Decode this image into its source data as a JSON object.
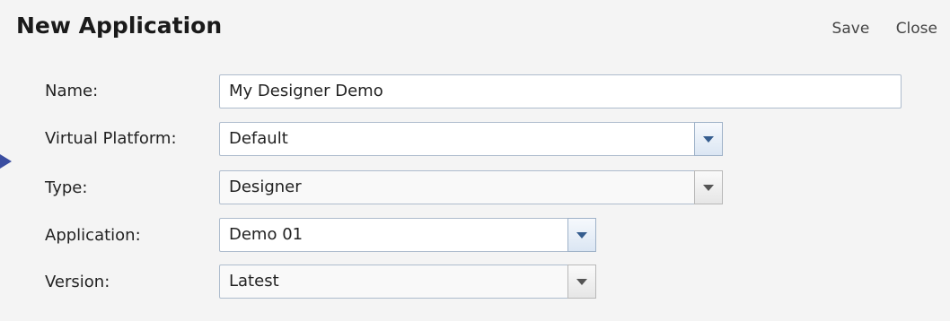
{
  "dialog": {
    "title": "New Application",
    "save_label": "Save",
    "close_label": "Close"
  },
  "fields": {
    "name": {
      "label": "Name:",
      "value": "My Designer Demo"
    },
    "virtual_platform": {
      "label": "Virtual Platform:",
      "value": "Default"
    },
    "type": {
      "label": "Type:",
      "value": "Designer"
    },
    "application": {
      "label": "Application:",
      "value": "Demo 01"
    },
    "version": {
      "label": "Version:",
      "value": "Latest"
    }
  },
  "icons": {
    "pointer": "arrow-right-icon",
    "dropdown": "chevron-down-icon"
  },
  "colors": {
    "background": "#f4f4f4",
    "input_border": "#aebccd",
    "pointer": "#3a4da0"
  }
}
